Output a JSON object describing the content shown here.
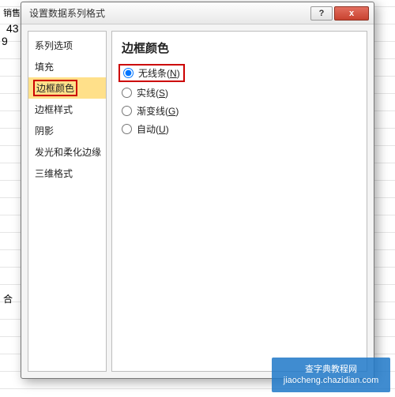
{
  "background": {
    "header_cell": "销售数量",
    "val1": "43",
    "val2": "9",
    "sum_label": "合"
  },
  "dialog": {
    "title": "设置数据系列格式",
    "help_tooltip": "?",
    "close_tooltip": "x"
  },
  "sidebar": {
    "items": [
      {
        "label": "系列选项"
      },
      {
        "label": "填充"
      },
      {
        "label": "边框颜色"
      },
      {
        "label": "边框样式"
      },
      {
        "label": "阴影"
      },
      {
        "label": "发光和柔化边缘"
      },
      {
        "label": "三维格式"
      }
    ],
    "selected_index": 2
  },
  "main": {
    "heading": "边框颜色",
    "options": [
      {
        "label": "无线条",
        "mnemonic": "N",
        "checked": true
      },
      {
        "label": "实线",
        "mnemonic": "S",
        "checked": false
      },
      {
        "label": "渐变线",
        "mnemonic": "G",
        "checked": false
      },
      {
        "label": "自动",
        "mnemonic": "U",
        "checked": false
      }
    ]
  },
  "watermark": {
    "line1": "查字典教程网",
    "line2": "jiaocheng.chazidian.com"
  }
}
